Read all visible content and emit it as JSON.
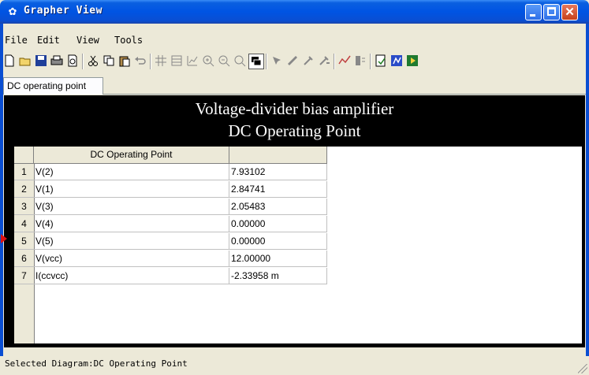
{
  "window": {
    "title": "Grapher View"
  },
  "menu": [
    "File",
    "Edit",
    "View",
    "Tools"
  ],
  "toolbar": {
    "icons": [
      "new-icon",
      "open-icon",
      "save-icon",
      "print-icon",
      "print-preview-icon",
      "cut-icon",
      "copy-icon",
      "paste-icon",
      "undo-icon",
      "grid-icon",
      "list-icon",
      "chart-icon",
      "zoom-in-icon",
      "zoom-out-icon",
      "zoom-fit-icon",
      "overlay-icon",
      "cursor-icon",
      "marker-icon",
      "probe-icon",
      "probe2-icon",
      "trace-icon",
      "legend-icon",
      "export-icon",
      "excel-icon",
      "run-icon"
    ]
  },
  "tabs": [
    {
      "label": "DC operating point",
      "active": true
    }
  ],
  "diagram": {
    "title_line1": "Voltage-divider bias amplifier",
    "title_line2": "DC Operating Point"
  },
  "table": {
    "header": "DC Operating Point",
    "rows": [
      {
        "num": "1",
        "name": "V(2)",
        "value": "7.93102"
      },
      {
        "num": "2",
        "name": "V(1)",
        "value": "2.84741"
      },
      {
        "num": "3",
        "name": "V(3)",
        "value": "2.05483"
      },
      {
        "num": "4",
        "name": "V(4)",
        "value": "0.00000"
      },
      {
        "num": "5",
        "name": "V(5)",
        "value": "0.00000"
      },
      {
        "num": "6",
        "name": "V(vcc)",
        "value": "12.00000"
      },
      {
        "num": "7",
        "name": "I(ccvcc)",
        "value": "-2.33958 m"
      }
    ]
  },
  "status": {
    "text": "Selected Diagram:DC Operating Point"
  },
  "colors": {
    "titlebar": "#0054e3",
    "panel_bg": "#000000",
    "marker": "#e01010"
  }
}
